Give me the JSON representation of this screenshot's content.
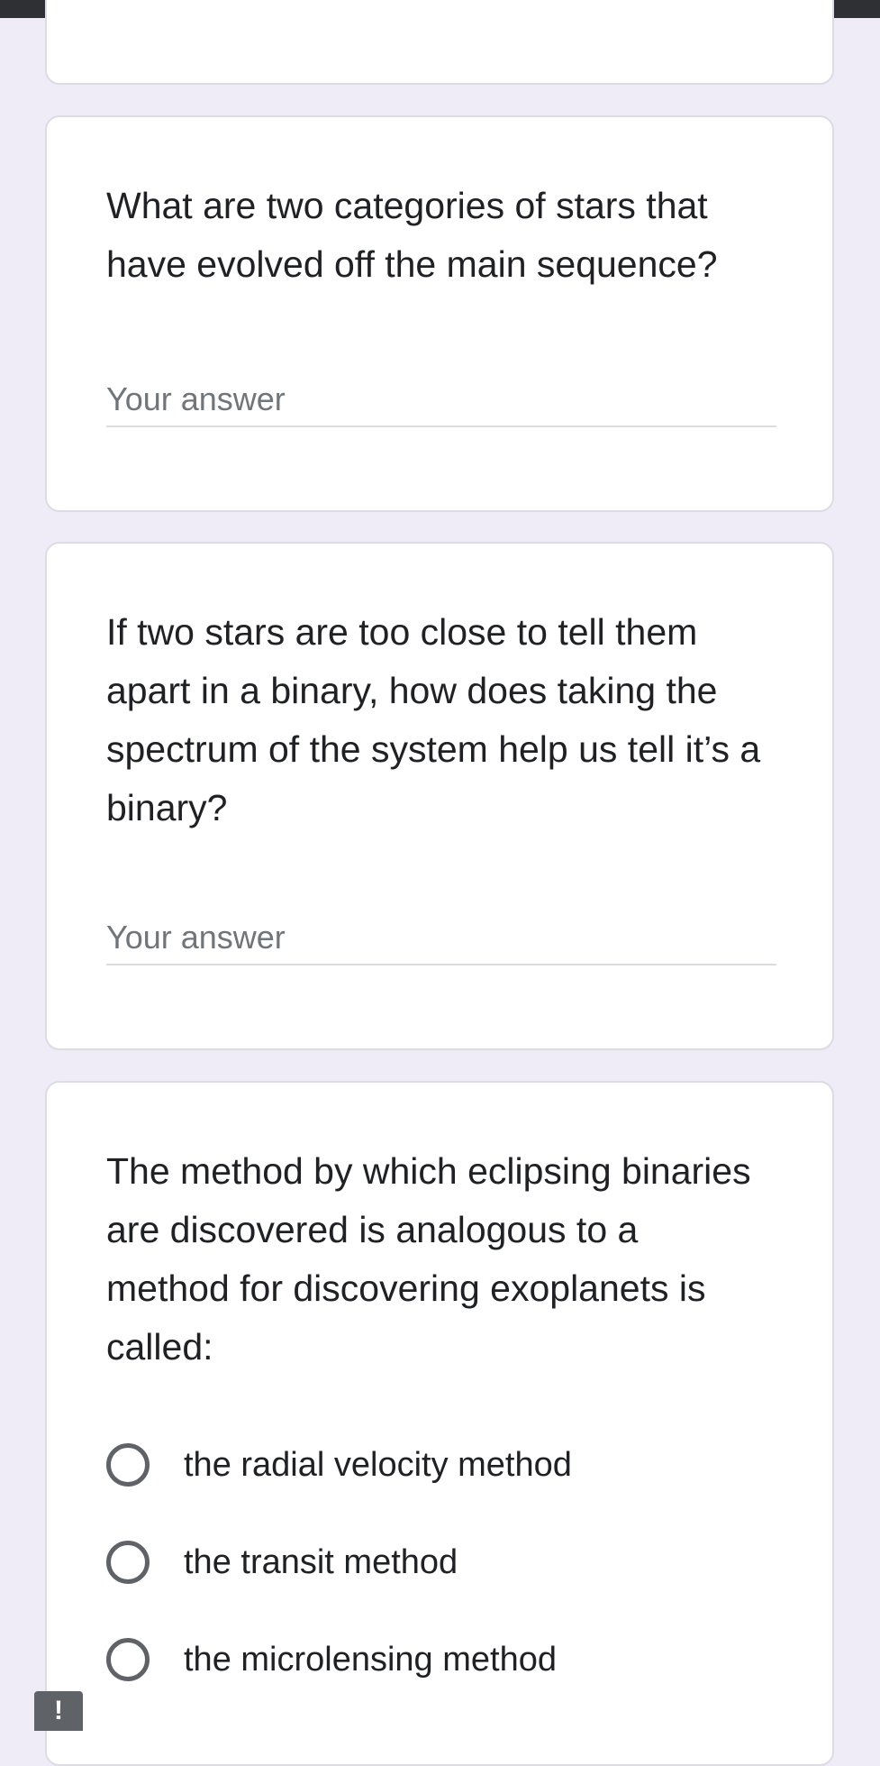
{
  "questions": [
    {
      "text": "What are two categories of stars that have evolved off the main sequence?",
      "placeholder": "Your answer"
    },
    {
      "text": "If two stars are too close to tell them apart in a binary, how does taking the spectrum of the system help us tell it’s a binary?",
      "placeholder": "Your answer"
    },
    {
      "text": "The method by which eclipsing binaries are discovered is analogous to a method for discovering exoplanets is called:",
      "options": [
        "the radial velocity method",
        "the transit method",
        "the microlensing method"
      ]
    }
  ],
  "report_button": {
    "label": "!"
  },
  "colors": {
    "background": "#efebf7",
    "card": "#ffffff",
    "text": "#202124",
    "placeholder": "#70757a",
    "status_bar": "#2f3033"
  }
}
